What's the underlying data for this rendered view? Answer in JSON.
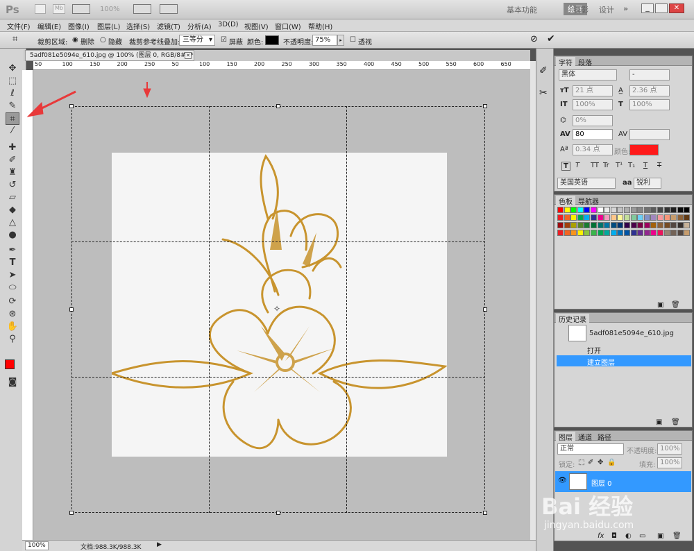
{
  "app": {
    "logo": "Ps",
    "zoom": "100%",
    "workspaces": [
      "基本功能",
      "绘画",
      "摄影",
      "设计"
    ],
    "active_workspace": "绘画",
    "more": "»"
  },
  "menu": [
    "文件(F)",
    "编辑(E)",
    "图像(I)",
    "图层(L)",
    "选择(S)",
    "滤镜(T)",
    "分析(A)",
    "3D(D)",
    "视图(V)",
    "窗口(W)",
    "帮助(H)"
  ],
  "options": {
    "crop_area_label": "裁剪区域:",
    "delete": "删除",
    "hide": "隐藏",
    "overlay_label": "裁剪参考线叠加:",
    "overlay_value": "三等分",
    "shield": "屏蔽",
    "color_label": "颜色:",
    "shield_color": "#000000",
    "opacity_label": "不透明度:",
    "opacity_value": "75%",
    "perspective": "透视"
  },
  "document": {
    "tab": "5adf081e5094e_610.jpg @ 100% (图层 0, RGB/8#) *",
    "ruler_marks": [
      "50",
      "100",
      "150",
      "200",
      "250",
      "50",
      "100",
      "150",
      "200",
      "250",
      "300",
      "350",
      "400",
      "450",
      "500",
      "550",
      "600",
      "650"
    ],
    "status_zoom": "100%",
    "status_doc": "文档:988.3K/988.3K"
  },
  "colors": {
    "foreground": "#ff0000",
    "background": "#00cc00",
    "accent": "#3399ff",
    "arrow": "#e8393a",
    "flower": "#c8942e"
  },
  "character": {
    "tabs": [
      "字符",
      "段落"
    ],
    "font": "黑体",
    "style": "-",
    "size": "21 点",
    "leading": "2.36 点",
    "vscale": "100%",
    "hscale": "100%",
    "tsume": "0%",
    "tracking": "80",
    "baseline": "0.34 点",
    "color_label": "颜色:",
    "text_color": "#ff1a1a",
    "style_buttons": [
      "T",
      "T",
      "TT",
      "Tr",
      "T¹",
      "T₁",
      "T",
      "T"
    ],
    "language": "美国英语",
    "aa_label": "aa",
    "aa": "锐利"
  },
  "swatches": {
    "tabs": [
      "色板",
      "导航器"
    ],
    "colors": [
      "#ff0000",
      "#ffff00",
      "#00ff00",
      "#00ffff",
      "#0000ff",
      "#ff00ff",
      "#ffffff",
      "#ebebeb",
      "#d6d6d6",
      "#c2c2c2",
      "#adadad",
      "#999999",
      "#858585",
      "#707070",
      "#5c5c5c",
      "#474747",
      "#333333",
      "#1f1f1f",
      "#0a0a0a",
      "#000000",
      "#ee1d24",
      "#f16522",
      "#fff100",
      "#00a650",
      "#00aeef",
      "#2e3092",
      "#ec008c",
      "#f49ac1",
      "#fdc689",
      "#fff799",
      "#c4df9b",
      "#82ca9c",
      "#6dcff6",
      "#8393ca",
      "#a187be",
      "#f6989d",
      "#f7977a",
      "#c69c6d",
      "#8c6239",
      "#603913",
      "#9e0b0f",
      "#a0410d",
      "#aba000",
      "#598527",
      "#1a7b30",
      "#007236",
      "#00746b",
      "#0076a3",
      "#004b80",
      "#003471",
      "#32004b",
      "#4b0049",
      "#7b0046",
      "#9e005d",
      "#a3620a",
      "#8c6239",
      "#754c24",
      "#534741",
      "#362f2d",
      "#c7b299",
      "#ed1c24",
      "#f26522",
      "#f7941d",
      "#fff200",
      "#8dc63f",
      "#39b54a",
      "#00a651",
      "#00a99d",
      "#00aeef",
      "#0072bc",
      "#0054a6",
      "#2e3192",
      "#662d91",
      "#92278f",
      "#ec008c",
      "#ed145b",
      "#998675",
      "#736357",
      "#534741",
      "#c69c6d"
    ]
  },
  "history": {
    "tab": "历史记录",
    "snapshot": "5adf081e5094e_610.jpg",
    "items": [
      "打开",
      "建立图层"
    ]
  },
  "layers": {
    "tabs": [
      "图层",
      "通道",
      "路径"
    ],
    "blend": "正常",
    "opacity_label": "不透明度:",
    "opacity": "100%",
    "lock_label": "锁定:",
    "fill_label": "填充:",
    "fill": "100%",
    "layer_name": "图层 0"
  },
  "watermark": {
    "brand": "Bai 经验",
    "url": "jingyan.baidu.com"
  }
}
